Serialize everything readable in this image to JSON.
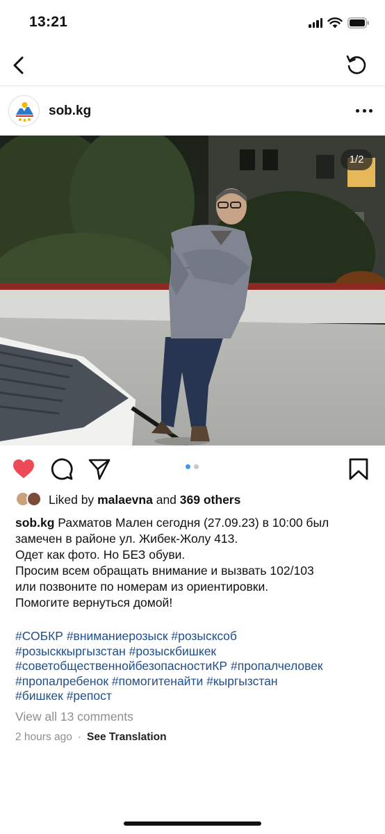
{
  "status_bar": {
    "time": "13:21"
  },
  "post": {
    "username": "sob.kg",
    "image_counter": "1/2",
    "likes": {
      "prefix": "Liked by",
      "user": "malaevna",
      "middle": "and",
      "others": "369 others"
    },
    "caption_lines": [
      "Рахматов Мален сегодня (27.09.23) в 10:00 был",
      "замечен в районе ул. Жибек-Жолу 413.",
      "Одет как фото. Но БЕЗ обуви.",
      "Просим всем обращать внимание и вызвать 102/103",
      "или позвоните по номерам из ориентировки.",
      "Помогите вернуться домой!"
    ],
    "hashtags": [
      "#СОБКР",
      "#вниманиерозыск",
      "#розыскcоб",
      "#розысккыргызстан",
      "#розыскбишкек",
      "#советобщественнойбезопасностиКР",
      "#пропалчеловек",
      "#пропалребенок",
      "#помогитенайти",
      "#кыргызстан",
      "#бишкек",
      "#репост"
    ],
    "view_comments": "View all 13 comments",
    "time_ago": "2 hours ago",
    "separator": "·",
    "see_translation": "See Translation"
  },
  "icons": {
    "back": "chevron-left-icon",
    "refresh": "refresh-icon",
    "more": "more-horizontal-icon",
    "like": "heart-icon",
    "comment": "comment-icon",
    "share": "send-icon",
    "save": "bookmark-icon"
  },
  "colors": {
    "like_red": "#ed4956",
    "hashtag_blue": "#1f4e8c",
    "muted_gray": "#8e8e8e",
    "carousel_active": "#3b97f2"
  }
}
